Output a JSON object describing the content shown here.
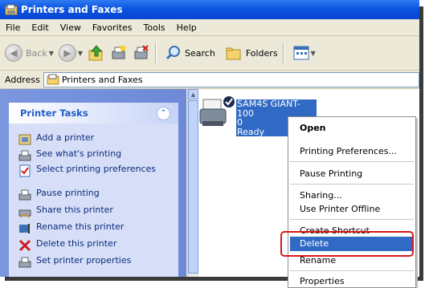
{
  "window": {
    "title": "Printers and Faxes"
  },
  "menu": [
    "File",
    "Edit",
    "View",
    "Favorites",
    "Tools",
    "Help"
  ],
  "toolbar": {
    "back": "Back",
    "search": "Search",
    "folders": "Folders"
  },
  "address": {
    "label": "Address",
    "value": "Printers and Faxes"
  },
  "tasks": {
    "title": "Printer Tasks",
    "items": [
      {
        "label": "Add a printer",
        "icon": "add-printer-icon"
      },
      {
        "label": "See what's printing",
        "icon": "print-queue-icon"
      },
      {
        "label": "Select printing preferences",
        "icon": "preferences-icon"
      },
      {
        "label": "Pause printing",
        "icon": "pause-printer-icon"
      },
      {
        "label": "Share this printer",
        "icon": "share-printer-icon"
      },
      {
        "label": "Rename this printer",
        "icon": "rename-icon"
      },
      {
        "label": "Delete this printer",
        "icon": "delete-x-icon"
      },
      {
        "label": "Set printer properties",
        "icon": "properties-icon"
      }
    ]
  },
  "printer": {
    "name_line1": "SAM4S GIANT-100",
    "name_line2": "0",
    "status": "Ready"
  },
  "context_menu": {
    "open": "Open",
    "printing_preferences": "Printing Preferences...",
    "pause_printing": "Pause Printing",
    "sharing": "Sharing...",
    "use_offline": "Use Printer Offline",
    "create_shortcut": "Create Shortcut",
    "delete": "Delete",
    "rename": "Rename",
    "properties": "Properties"
  },
  "colors": {
    "title_blue": "#0a54e2",
    "task_pane": "#7a96df",
    "selection": "#316ac5",
    "highlight_ring": "#d8181c"
  }
}
